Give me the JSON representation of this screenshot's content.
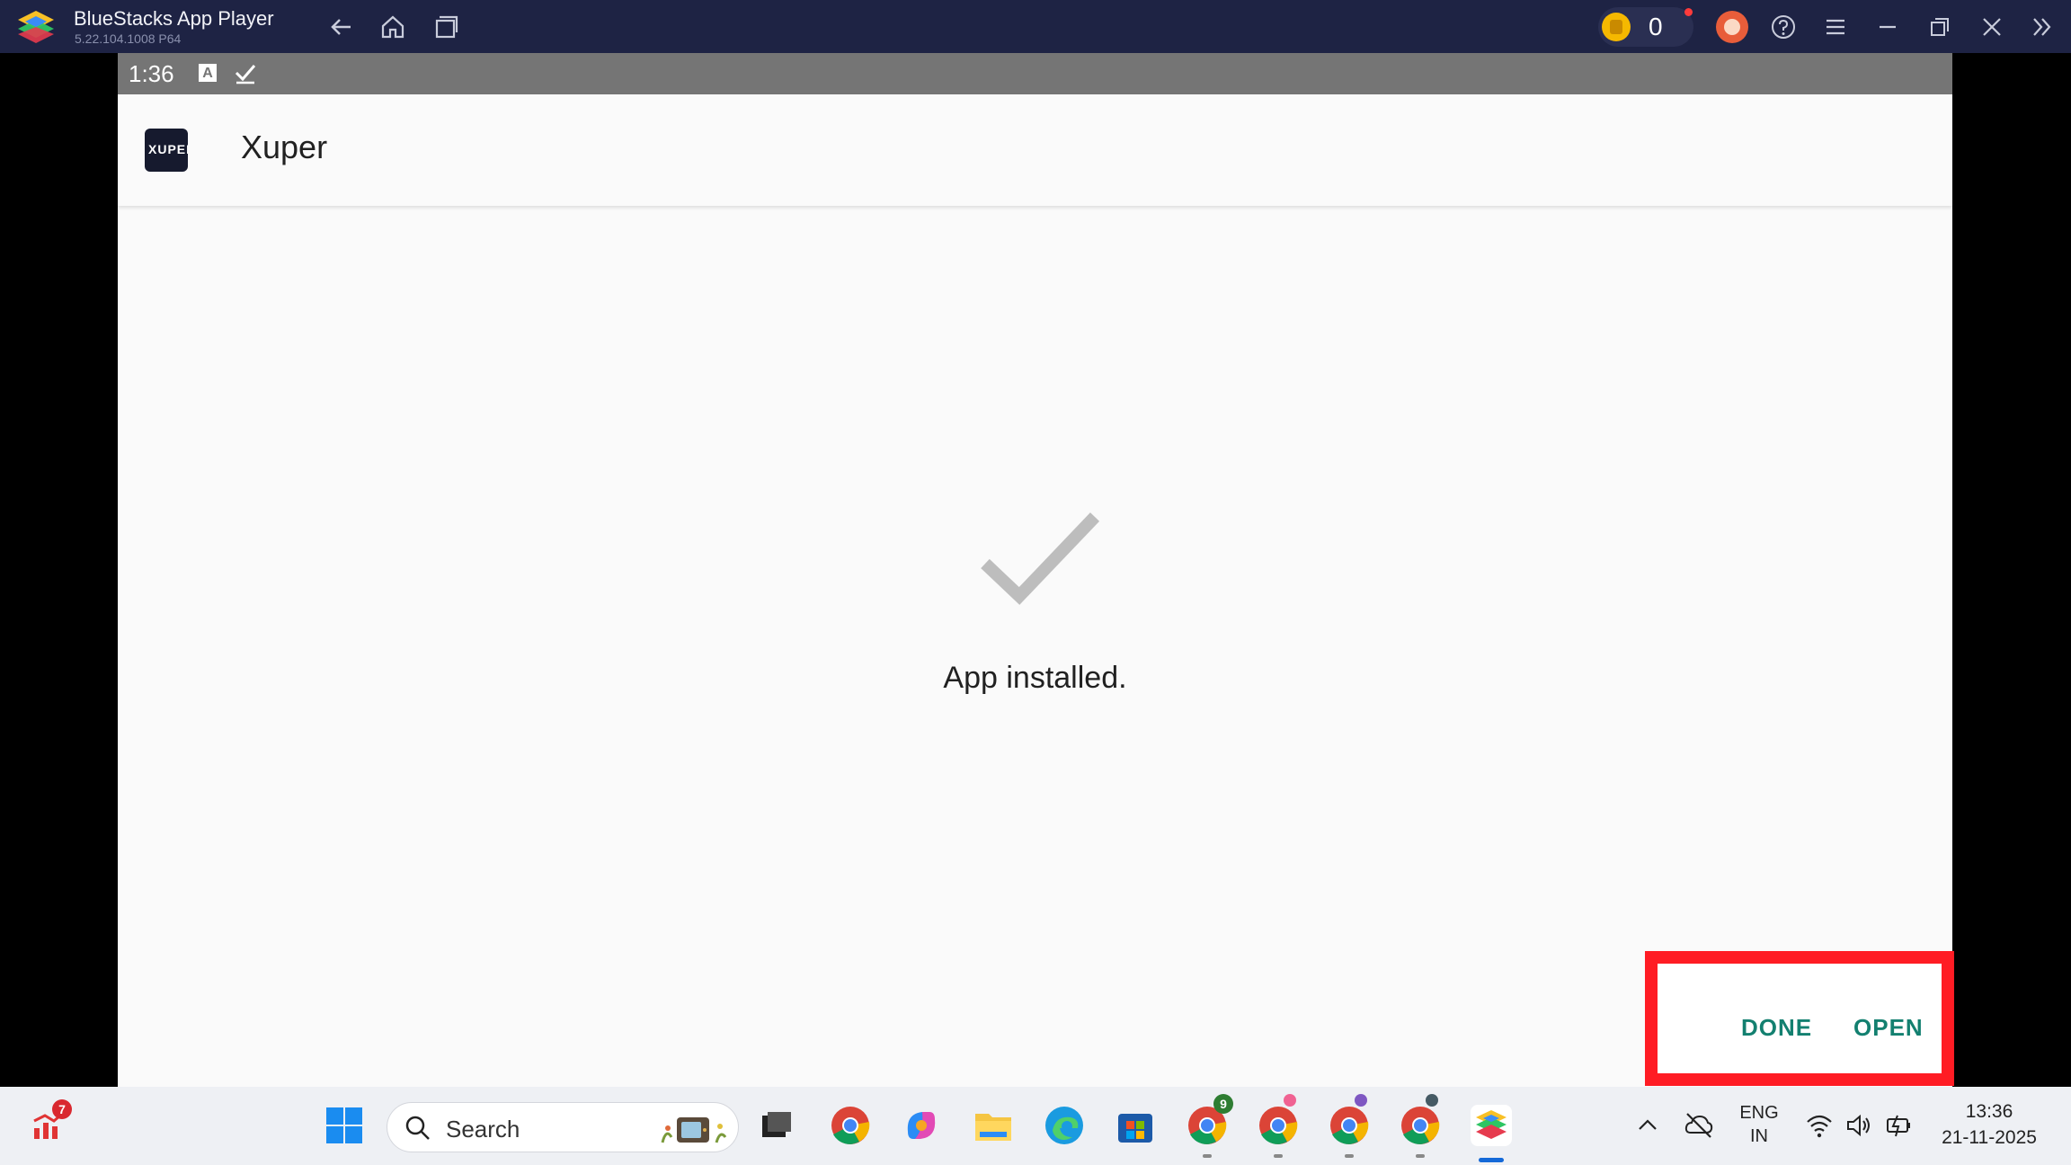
{
  "window": {
    "title": "BlueStacks App Player",
    "version": "5.22.104.1008  P64",
    "coins": "0"
  },
  "android": {
    "status_time": "1:36",
    "status_a": "A",
    "app_name": "Xuper",
    "app_icon_text": "XUPER",
    "message": "App installed.",
    "done_label": "DONE",
    "open_label": "OPEN",
    "colors": {
      "accent": "#138070",
      "highlight": "#ff1c24"
    }
  },
  "taskbar": {
    "search_placeholder": "Search",
    "widget_badge": "7",
    "chrome_badges": [
      "9",
      "",
      "",
      ""
    ],
    "language": "ENG",
    "region": "IN",
    "time": "13:36",
    "date": "21-11-2025"
  }
}
